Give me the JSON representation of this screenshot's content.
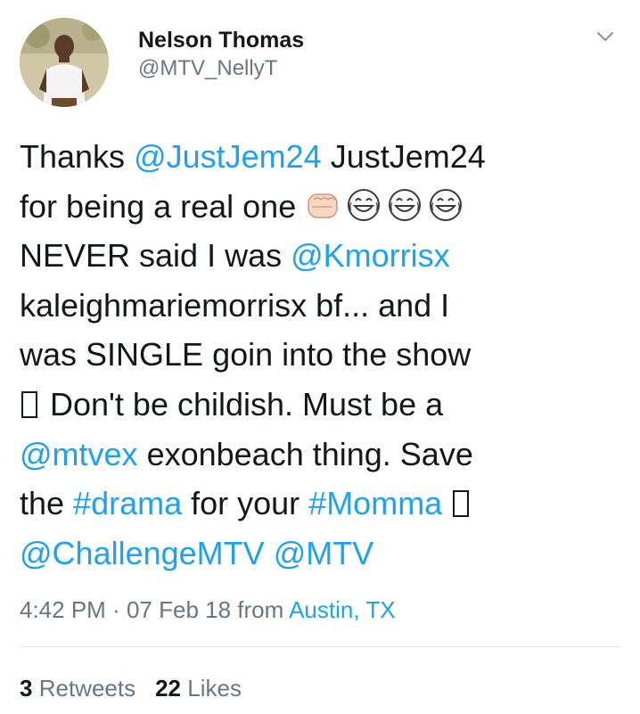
{
  "author": {
    "display_name": "Nelson Thomas",
    "handle": "@MTV_NellyT"
  },
  "tweet": {
    "lines": [
      [
        {
          "t": "Thanks "
        },
        {
          "t": "@JustJem24",
          "link": true
        },
        {
          "t": " JustJem24"
        }
      ],
      [
        {
          "t": "for being a real one "
        },
        {
          "emoji": "fist-bump-emoji"
        },
        {
          "emoji": "tears-of-joy-emoji"
        },
        {
          "emoji": "tears-of-joy-emoji"
        },
        {
          "emoji": "tears-of-joy-emoji"
        }
      ],
      [
        {
          "t": "NEVER said I was "
        },
        {
          "t": "@Kmorrisx",
          "link": true
        }
      ],
      [
        {
          "t": "kaleighmariemorrisx bf... and I"
        }
      ],
      [
        {
          "t": "was SINGLE goin into the show"
        }
      ],
      [
        {
          "glyph": "missing-glyph-box"
        },
        {
          "t": " Don't be childish. Must be a"
        }
      ],
      [
        {
          "t": "@mtvex",
          "link": true
        },
        {
          "t": " exonbeach thing. Save"
        }
      ],
      [
        {
          "t": "the "
        },
        {
          "t": "#drama",
          "link": true
        },
        {
          "t": " for your "
        },
        {
          "t": "#Momma",
          "link": true
        },
        {
          "t": " "
        },
        {
          "glyph": "missing-glyph-box"
        }
      ],
      [
        {
          "t": "@ChallengeMTV",
          "link": true
        },
        {
          "t": " "
        },
        {
          "t": "@MTV",
          "link": true
        }
      ]
    ]
  },
  "meta": {
    "time": "4:42 PM",
    "separator": "·",
    "date": "07 Feb 18",
    "from_label": "from",
    "location": "Austin, TX"
  },
  "stats": {
    "retweets_count": "3",
    "retweets_label": "Retweets",
    "likes_count": "22",
    "likes_label": "Likes"
  },
  "colors": {
    "link": "#1da1f2",
    "secondary_text": "#657786",
    "primary_text": "#14171a"
  },
  "icons": {
    "menu": "chevron-down-icon"
  }
}
